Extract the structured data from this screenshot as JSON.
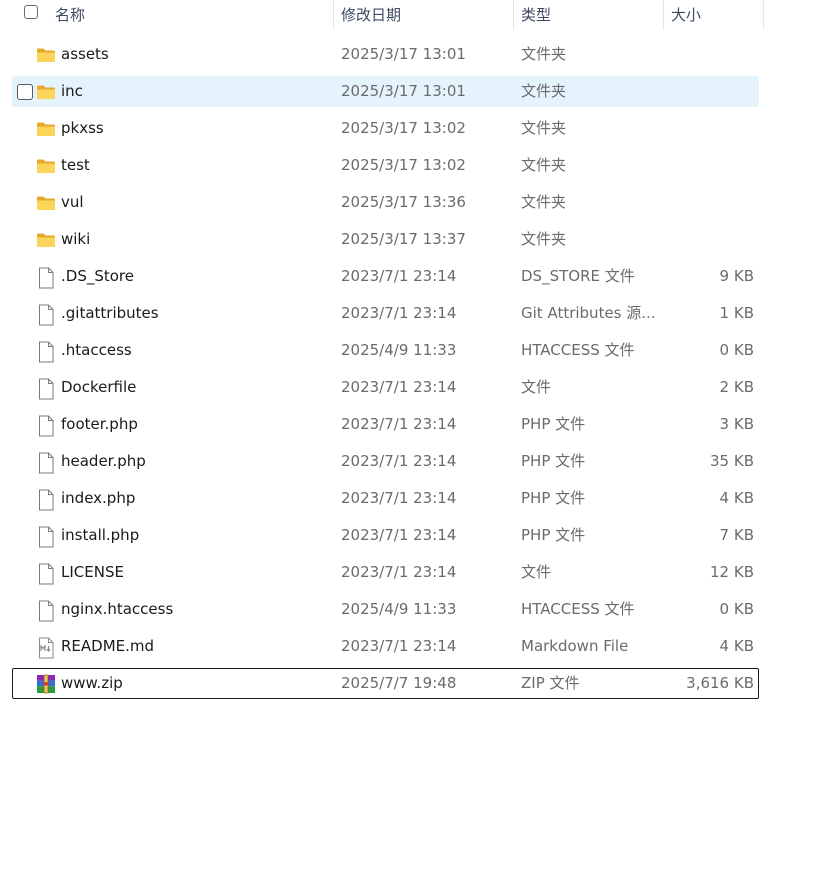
{
  "columns": {
    "name": "名称",
    "modified": "修改日期",
    "type": "类型",
    "size": "大小"
  },
  "files": [
    {
      "name": "assets",
      "modified": "2025/3/17 13:01",
      "type": "文件夹",
      "size": "",
      "icon": "folder-icon"
    },
    {
      "name": "inc",
      "modified": "2025/3/17 13:01",
      "type": "文件夹",
      "size": "",
      "icon": "folder-icon",
      "selected": true
    },
    {
      "name": "pkxss",
      "modified": "2025/3/17 13:02",
      "type": "文件夹",
      "size": "",
      "icon": "folder-icon"
    },
    {
      "name": "test",
      "modified": "2025/3/17 13:02",
      "type": "文件夹",
      "size": "",
      "icon": "folder-icon"
    },
    {
      "name": "vul",
      "modified": "2025/3/17 13:36",
      "type": "文件夹",
      "size": "",
      "icon": "folder-icon"
    },
    {
      "name": "wiki",
      "modified": "2025/3/17 13:37",
      "type": "文件夹",
      "size": "",
      "icon": "folder-icon"
    },
    {
      "name": ".DS_Store",
      "modified": "2023/7/1 23:14",
      "type": "DS_STORE 文件",
      "size": "9 KB",
      "icon": "file-icon"
    },
    {
      "name": ".gitattributes",
      "modified": "2023/7/1 23:14",
      "type": "Git Attributes 源...",
      "size": "1 KB",
      "icon": "file-icon"
    },
    {
      "name": ".htaccess",
      "modified": "2025/4/9 11:33",
      "type": "HTACCESS 文件",
      "size": "0 KB",
      "icon": "file-icon"
    },
    {
      "name": "Dockerfile",
      "modified": "2023/7/1 23:14",
      "type": "文件",
      "size": "2 KB",
      "icon": "file-icon"
    },
    {
      "name": "footer.php",
      "modified": "2023/7/1 23:14",
      "type": "PHP 文件",
      "size": "3 KB",
      "icon": "file-icon"
    },
    {
      "name": "header.php",
      "modified": "2023/7/1 23:14",
      "type": "PHP 文件",
      "size": "35 KB",
      "icon": "file-icon"
    },
    {
      "name": "index.php",
      "modified": "2023/7/1 23:14",
      "type": "PHP 文件",
      "size": "4 KB",
      "icon": "file-icon"
    },
    {
      "name": "install.php",
      "modified": "2023/7/1 23:14",
      "type": "PHP 文件",
      "size": "7 KB",
      "icon": "file-icon"
    },
    {
      "name": "LICENSE",
      "modified": "2023/7/1 23:14",
      "type": "文件",
      "size": "12 KB",
      "icon": "file-icon"
    },
    {
      "name": "nginx.htaccess",
      "modified": "2025/4/9 11:33",
      "type": "HTACCESS 文件",
      "size": "0 KB",
      "icon": "file-icon"
    },
    {
      "name": "README.md",
      "modified": "2023/7/1 23:14",
      "type": "Markdown File",
      "size": "4 KB",
      "icon": "markdown-file-icon"
    },
    {
      "name": "www.zip",
      "modified": "2025/7/7 19:48",
      "type": "ZIP 文件",
      "size": "3,616 KB",
      "icon": "zip-archive-icon",
      "focused": true
    }
  ],
  "colors": {
    "selected_bg": "#e5f3fd",
    "folder": "#f8c43c",
    "secondary_text": "#6b6b6b"
  }
}
